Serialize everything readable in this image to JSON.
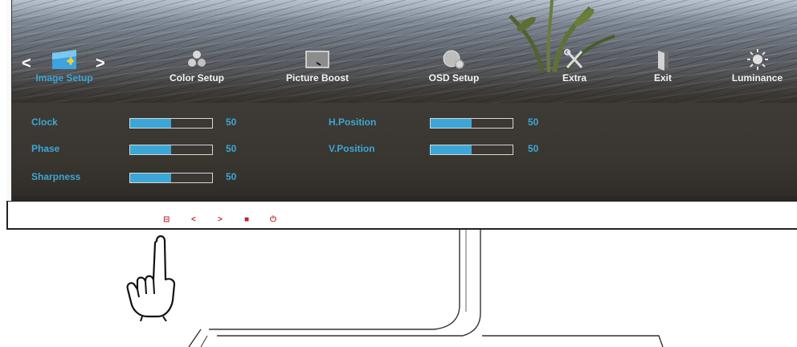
{
  "osd": {
    "menu": [
      {
        "label": "Image Setup",
        "icon": "image-setup-icon",
        "active": true
      },
      {
        "label": "Color Setup",
        "icon": "color-setup-icon",
        "active": false
      },
      {
        "label": "Picture Boost",
        "icon": "picture-boost-icon",
        "active": false
      },
      {
        "label": "OSD Setup",
        "icon": "osd-setup-icon",
        "active": false
      },
      {
        "label": "Extra",
        "icon": "extra-icon",
        "active": false
      },
      {
        "label": "Exit",
        "icon": "exit-icon",
        "active": false
      },
      {
        "label": "Luminance",
        "icon": "luminance-icon",
        "active": false
      }
    ],
    "nav_left": "<",
    "nav_right": ">",
    "settings_left": [
      {
        "name": "Clock",
        "value": "50",
        "level": 0.5
      },
      {
        "name": "Phase",
        "value": "50",
        "level": 0.5
      },
      {
        "name": "Sharpness",
        "value": "50",
        "level": 0.5
      }
    ],
    "settings_right": [
      {
        "name": "H.Position",
        "value": "50",
        "level": 0.5
      },
      {
        "name": "V.Position",
        "value": "50",
        "level": 0.5
      }
    ]
  },
  "bezel_buttons": [
    {
      "icon": "source-icon",
      "glyph": "⊟"
    },
    {
      "icon": "left-icon",
      "glyph": "<"
    },
    {
      "icon": "right-icon",
      "glyph": ">"
    },
    {
      "icon": "menu-icon",
      "glyph": "■"
    },
    {
      "icon": "power-icon",
      "glyph": "⏻"
    }
  ],
  "colors": {
    "accent": "#3ca7d6",
    "button_red": "#c0262b",
    "panel": "#3b3733"
  }
}
